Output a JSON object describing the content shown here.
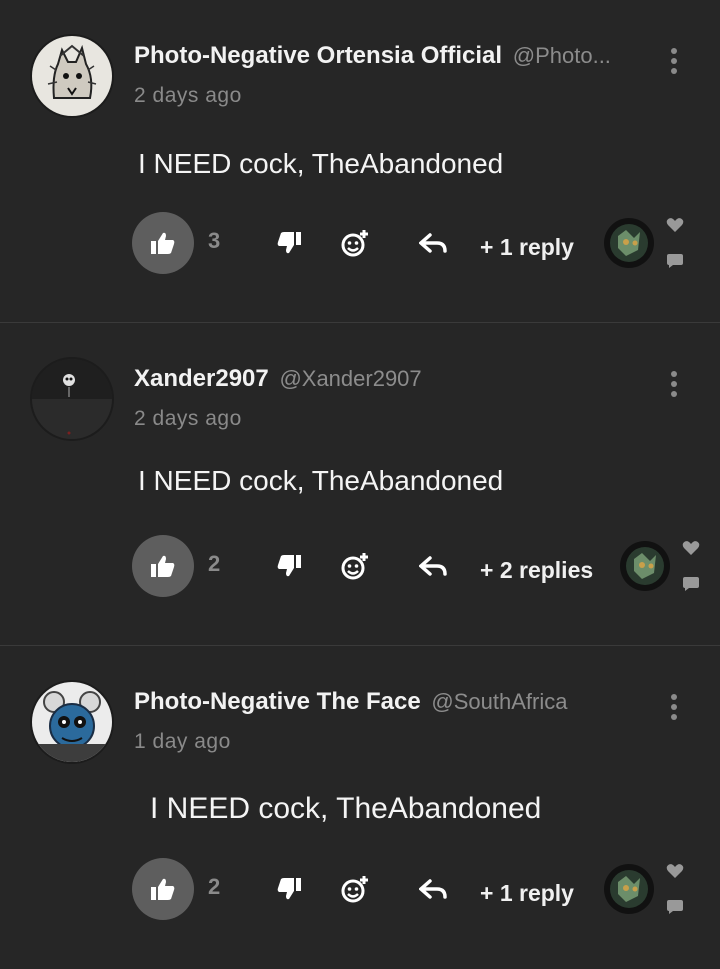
{
  "comments": [
    {
      "name": "Photo-Negative Ortensia Official",
      "handle": "@Photo...",
      "time": "2 days ago",
      "text": "I NEED cock, TheAbandoned",
      "likes": "3",
      "replies": "+ 1 reply",
      "avatar_icon": "sketch-cat-avatar"
    },
    {
      "name": "Xander2907",
      "handle": "@Xander2907",
      "time": "2 days ago",
      "text": "I NEED cock, TheAbandoned",
      "likes": "2",
      "replies": "+ 2 replies",
      "avatar_icon": "dark-figure-avatar"
    },
    {
      "name": "Photo-Negative The Face",
      "handle": "@SouthAfrica",
      "time": "1 day ago",
      "text": "I NEED cock, TheAbandoned",
      "likes": "2",
      "replies": "+ 1 reply",
      "avatar_icon": "blue-mouse-avatar"
    }
  ],
  "colors": {
    "background": "#262626",
    "like_button": "#5e5e5e",
    "muted_text": "#8a8a8a"
  }
}
